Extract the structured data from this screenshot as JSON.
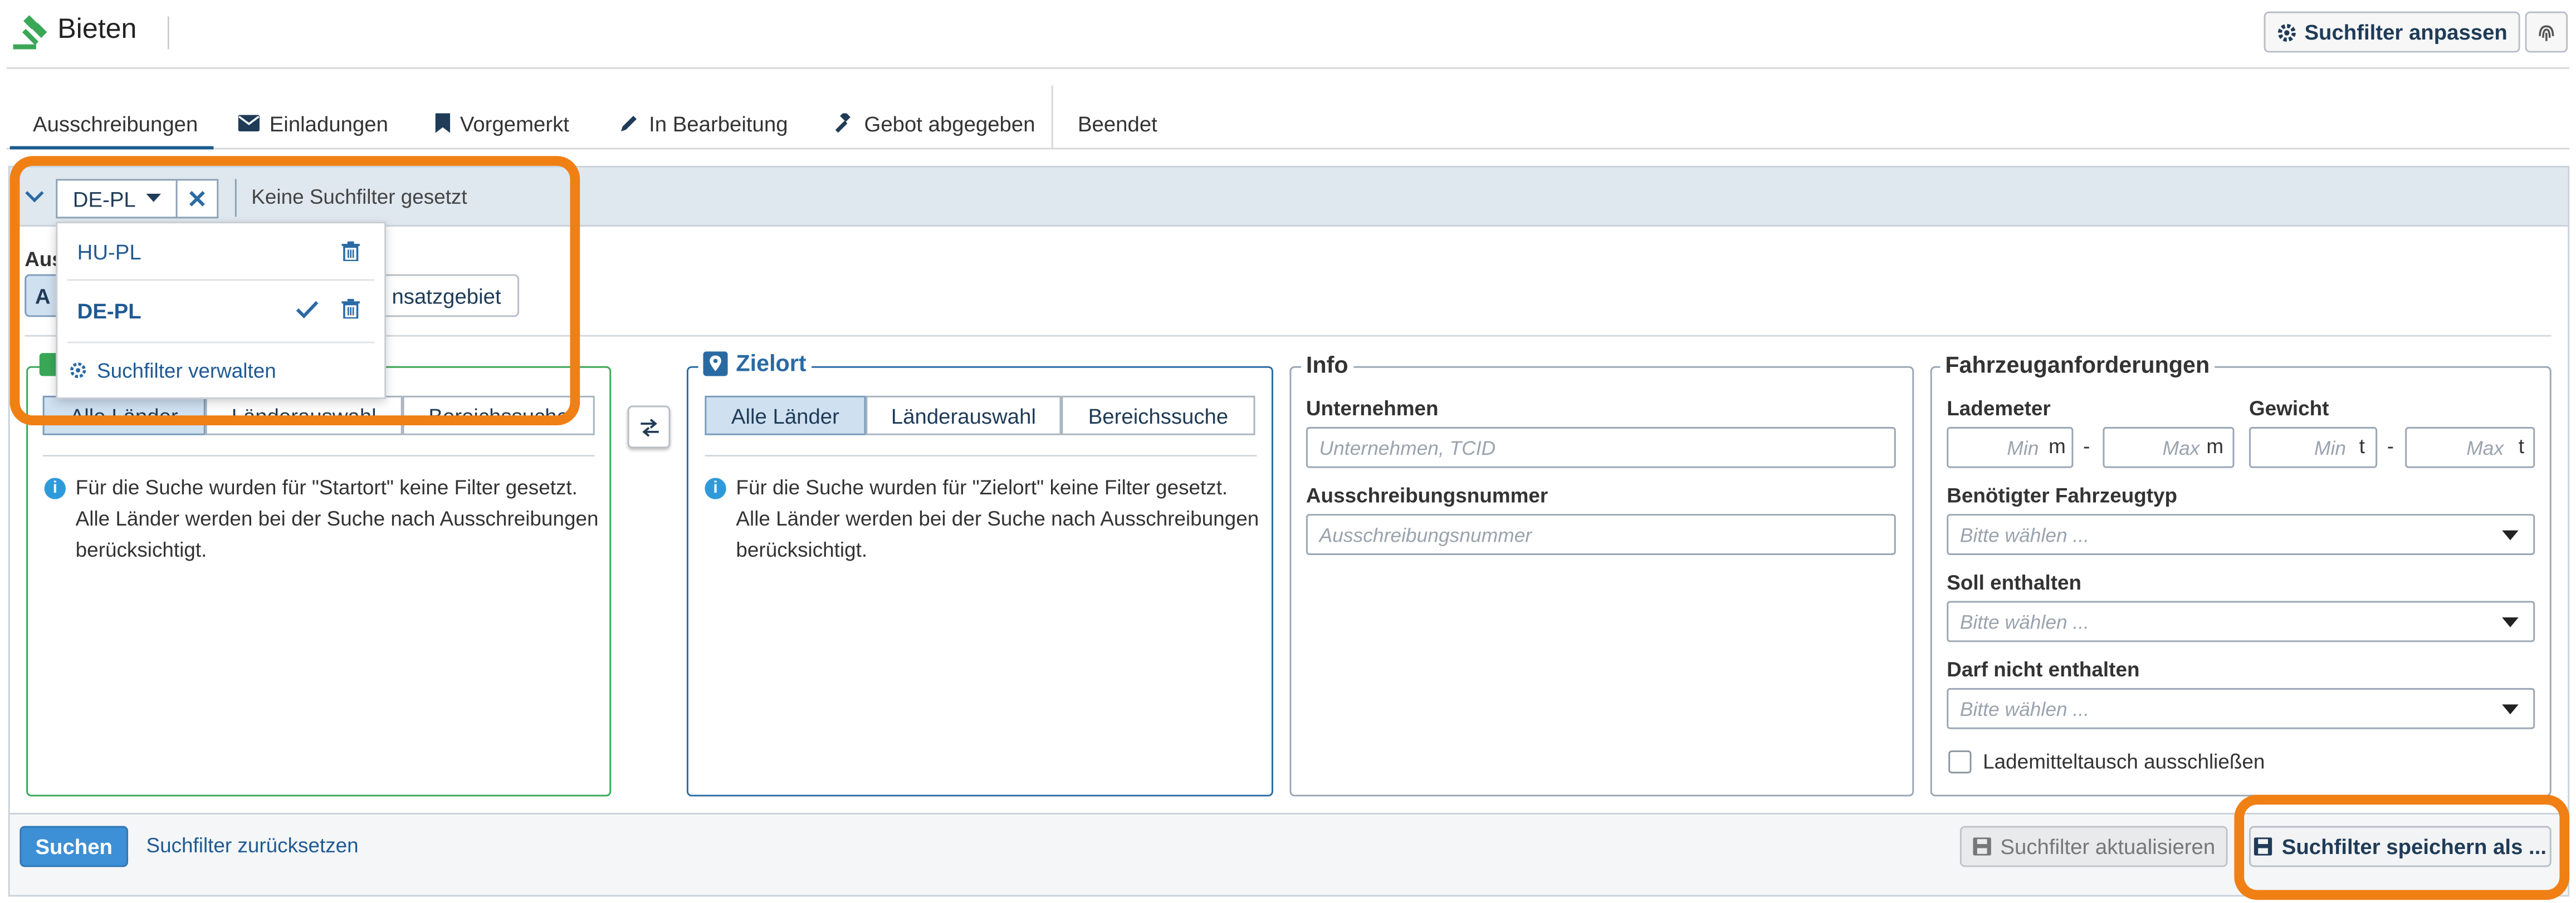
{
  "header": {
    "title": "Bieten",
    "customize_filter_label": "Suchfilter anpassen"
  },
  "tabs": [
    {
      "label": "Ausschreibungen",
      "icon": "none",
      "active": true
    },
    {
      "label": "Einladungen",
      "icon": "envelope-icon"
    },
    {
      "label": "Vorgemerkt",
      "icon": "bookmark-icon"
    },
    {
      "label": "In Bearbeitung",
      "icon": "pencil-icon"
    },
    {
      "label": "Gebot abgegeben",
      "icon": "gavel-icon"
    },
    {
      "label": "Beendet",
      "icon": "none"
    }
  ],
  "filter_bar": {
    "selected_filter": "DE-PL",
    "no_filter_text": "Keine Suchfilter gesetzt"
  },
  "filter_dropdown": {
    "items": [
      {
        "label": "HU-PL",
        "selected": false
      },
      {
        "label": "DE-PL",
        "selected": true
      }
    ],
    "manage_label": "Suchfilter verwalten"
  },
  "partial": {
    "label_fragment": "Aus",
    "button_fragment_a": "A",
    "button_fragment_b": "nsatzgebiet"
  },
  "start": {
    "legend": "",
    "segments": [
      "Alle Länder",
      "Länderauswahl",
      "Bereichssuche"
    ],
    "active_segment": 0,
    "info": "Für die Suche wurden für \"Startort\" keine Filter gesetzt. Alle Länder werden bei der Suche nach Ausschreibungen berücksichtigt."
  },
  "destination": {
    "legend": "Zielort",
    "segments": [
      "Alle Länder",
      "Länderauswahl",
      "Bereichssuche"
    ],
    "active_segment": 0,
    "info": "Für die Suche wurden für \"Zielort\" keine Filter gesetzt. Alle Länder werden bei der Suche nach Ausschreibungen berücksichtigt."
  },
  "info_box": {
    "legend": "Info",
    "company_label": "Unternehmen",
    "company_placeholder": "Unternehmen, TCID",
    "tender_label": "Ausschreibungsnummer",
    "tender_placeholder": "Ausschreibungsnummer"
  },
  "vehicle": {
    "legend": "Fahrzeuganforderungen",
    "loading_meters_label": "Lademeter",
    "weight_label": "Gewicht",
    "min_placeholder": "Min",
    "max_placeholder": "Max",
    "unit_m": "m",
    "unit_t": "t",
    "range_sep": "-",
    "vehicle_type_label": "Benötigter Fahrzeugtyp",
    "should_contain_label": "Soll enthalten",
    "must_not_contain_label": "Darf nicht enthalten",
    "select_placeholder": "Bitte wählen ...",
    "exclude_exchange_label": "Lademitteltausch ausschließen",
    "exclude_exchange_checked": false
  },
  "footer": {
    "search_label": "Suchen",
    "reset_label": "Suchfilter zurücksetzen",
    "update_label": "Suchfilter aktualisieren",
    "save_as_label": "Suchfilter speichern als ..."
  },
  "colors": {
    "accent_blue": "#2a6aa3",
    "start_green": "#3aa757",
    "highlight_orange": "#f07f14",
    "primary_button": "#3d8fd6"
  }
}
